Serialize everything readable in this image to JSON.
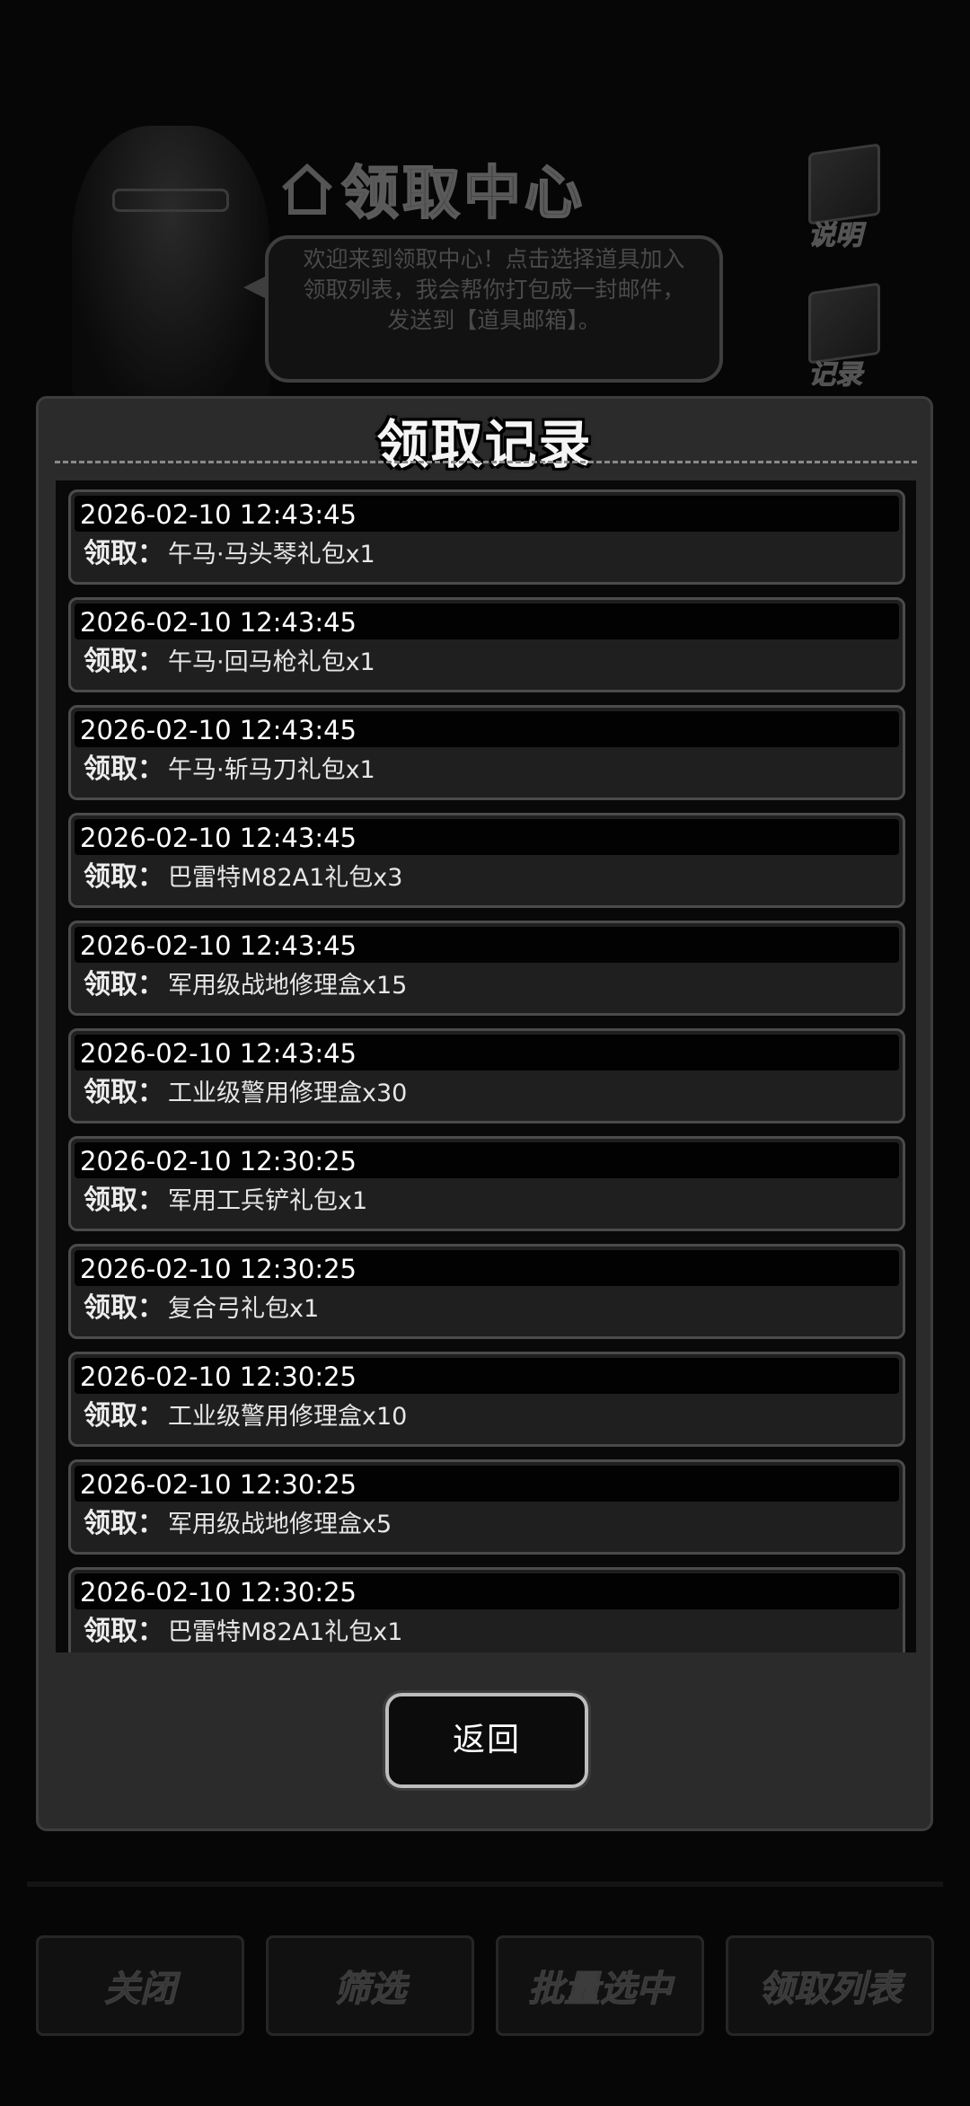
{
  "background": {
    "title": "领取中心",
    "welcome_message": "欢迎来到领取中心！点击选择道具加入领取列表，我会帮你打包成一封邮件，发送到【道具邮箱】。",
    "side_buttons": [
      "说明",
      "记录"
    ],
    "bottom_buttons": [
      "关闭",
      "筛选",
      "批量选中",
      "领取列表"
    ]
  },
  "dialog": {
    "title": "领取记录",
    "back_label": "返回",
    "claim_label": "领取：",
    "records": [
      {
        "time": "2026-02-10 12:43:45",
        "item": "午马·马头琴礼包x1"
      },
      {
        "time": "2026-02-10 12:43:45",
        "item": "午马·回马枪礼包x1"
      },
      {
        "time": "2026-02-10 12:43:45",
        "item": "午马·斩马刀礼包x1"
      },
      {
        "time": "2026-02-10 12:43:45",
        "item": "巴雷特M82A1礼包x3"
      },
      {
        "time": "2026-02-10 12:43:45",
        "item": "军用级战地修理盒x15"
      },
      {
        "time": "2026-02-10 12:43:45",
        "item": "工业级警用修理盒x30"
      },
      {
        "time": "2026-02-10 12:30:25",
        "item": "军用工兵铲礼包x1"
      },
      {
        "time": "2026-02-10 12:30:25",
        "item": "复合弓礼包x1"
      },
      {
        "time": "2026-02-10 12:30:25",
        "item": "工业级警用修理盒x10"
      },
      {
        "time": "2026-02-10 12:30:25",
        "item": "军用级战地修理盒x5"
      },
      {
        "time": "2026-02-10 12:30:25",
        "item": "巴雷特M82A1礼包x1"
      }
    ]
  }
}
